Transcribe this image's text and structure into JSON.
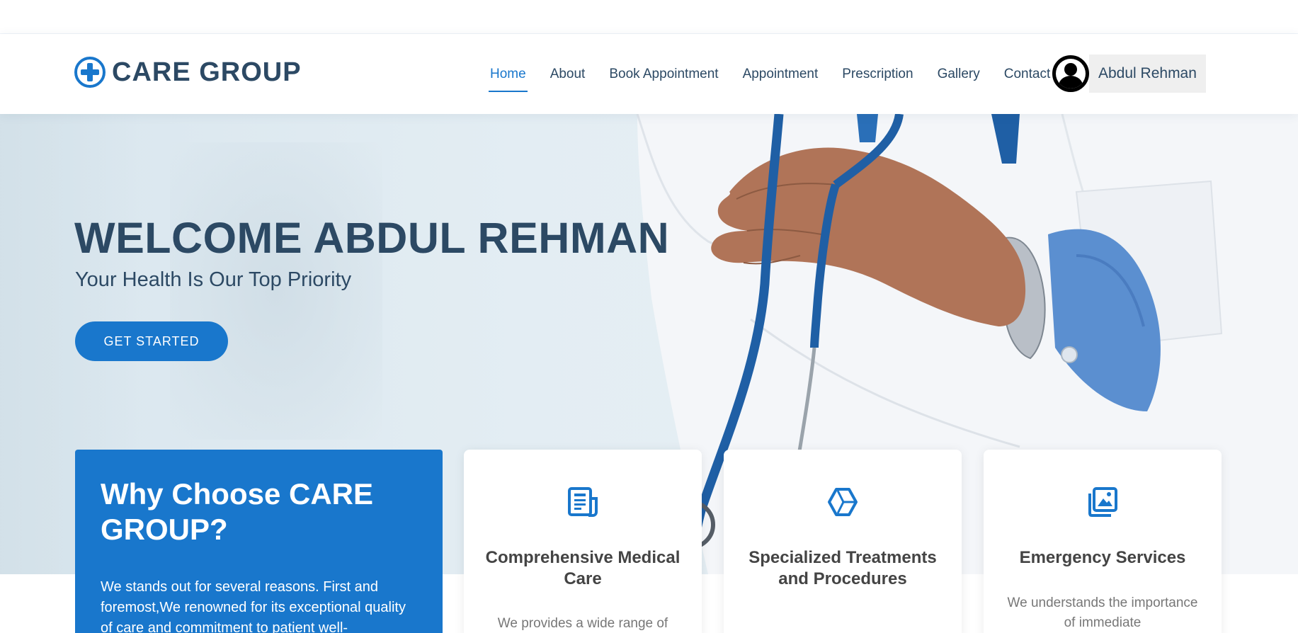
{
  "brand": {
    "name": "CARE GROUP"
  },
  "nav": {
    "items": [
      {
        "label": "Home",
        "active": true
      },
      {
        "label": "About",
        "active": false
      },
      {
        "label": "Book Appointment",
        "active": false
      },
      {
        "label": "Appointment",
        "active": false
      },
      {
        "label": "Prescription",
        "active": false
      },
      {
        "label": "Gallery",
        "active": false
      },
      {
        "label": "Contact",
        "active": false
      }
    ]
  },
  "user": {
    "name": "Abdul Rehman"
  },
  "hero": {
    "title": "WELCOME ABDUL REHMAN",
    "subtitle": "Your Health Is Our Top Priority",
    "cta_label": "GET STARTED"
  },
  "why": {
    "title": "Why Choose CARE GROUP?",
    "text": "We stands out for several reasons. First and foremost,We renowned for its exceptional quality of care and commitment to patient well-"
  },
  "cards": [
    {
      "icon": "document-icon",
      "title": "Comprehensive Medical Care",
      "text": "We provides a wide range of"
    },
    {
      "icon": "hexagon-icon",
      "title": "Specialized Treatments and Procedures",
      "text": ""
    },
    {
      "icon": "images-icon",
      "title": "Emergency Services",
      "text": "We understands the importance of immediate"
    }
  ],
  "colors": {
    "accent": "#1977cc",
    "heading": "#2c4964",
    "card_title": "#444444",
    "card_text": "#777777"
  }
}
